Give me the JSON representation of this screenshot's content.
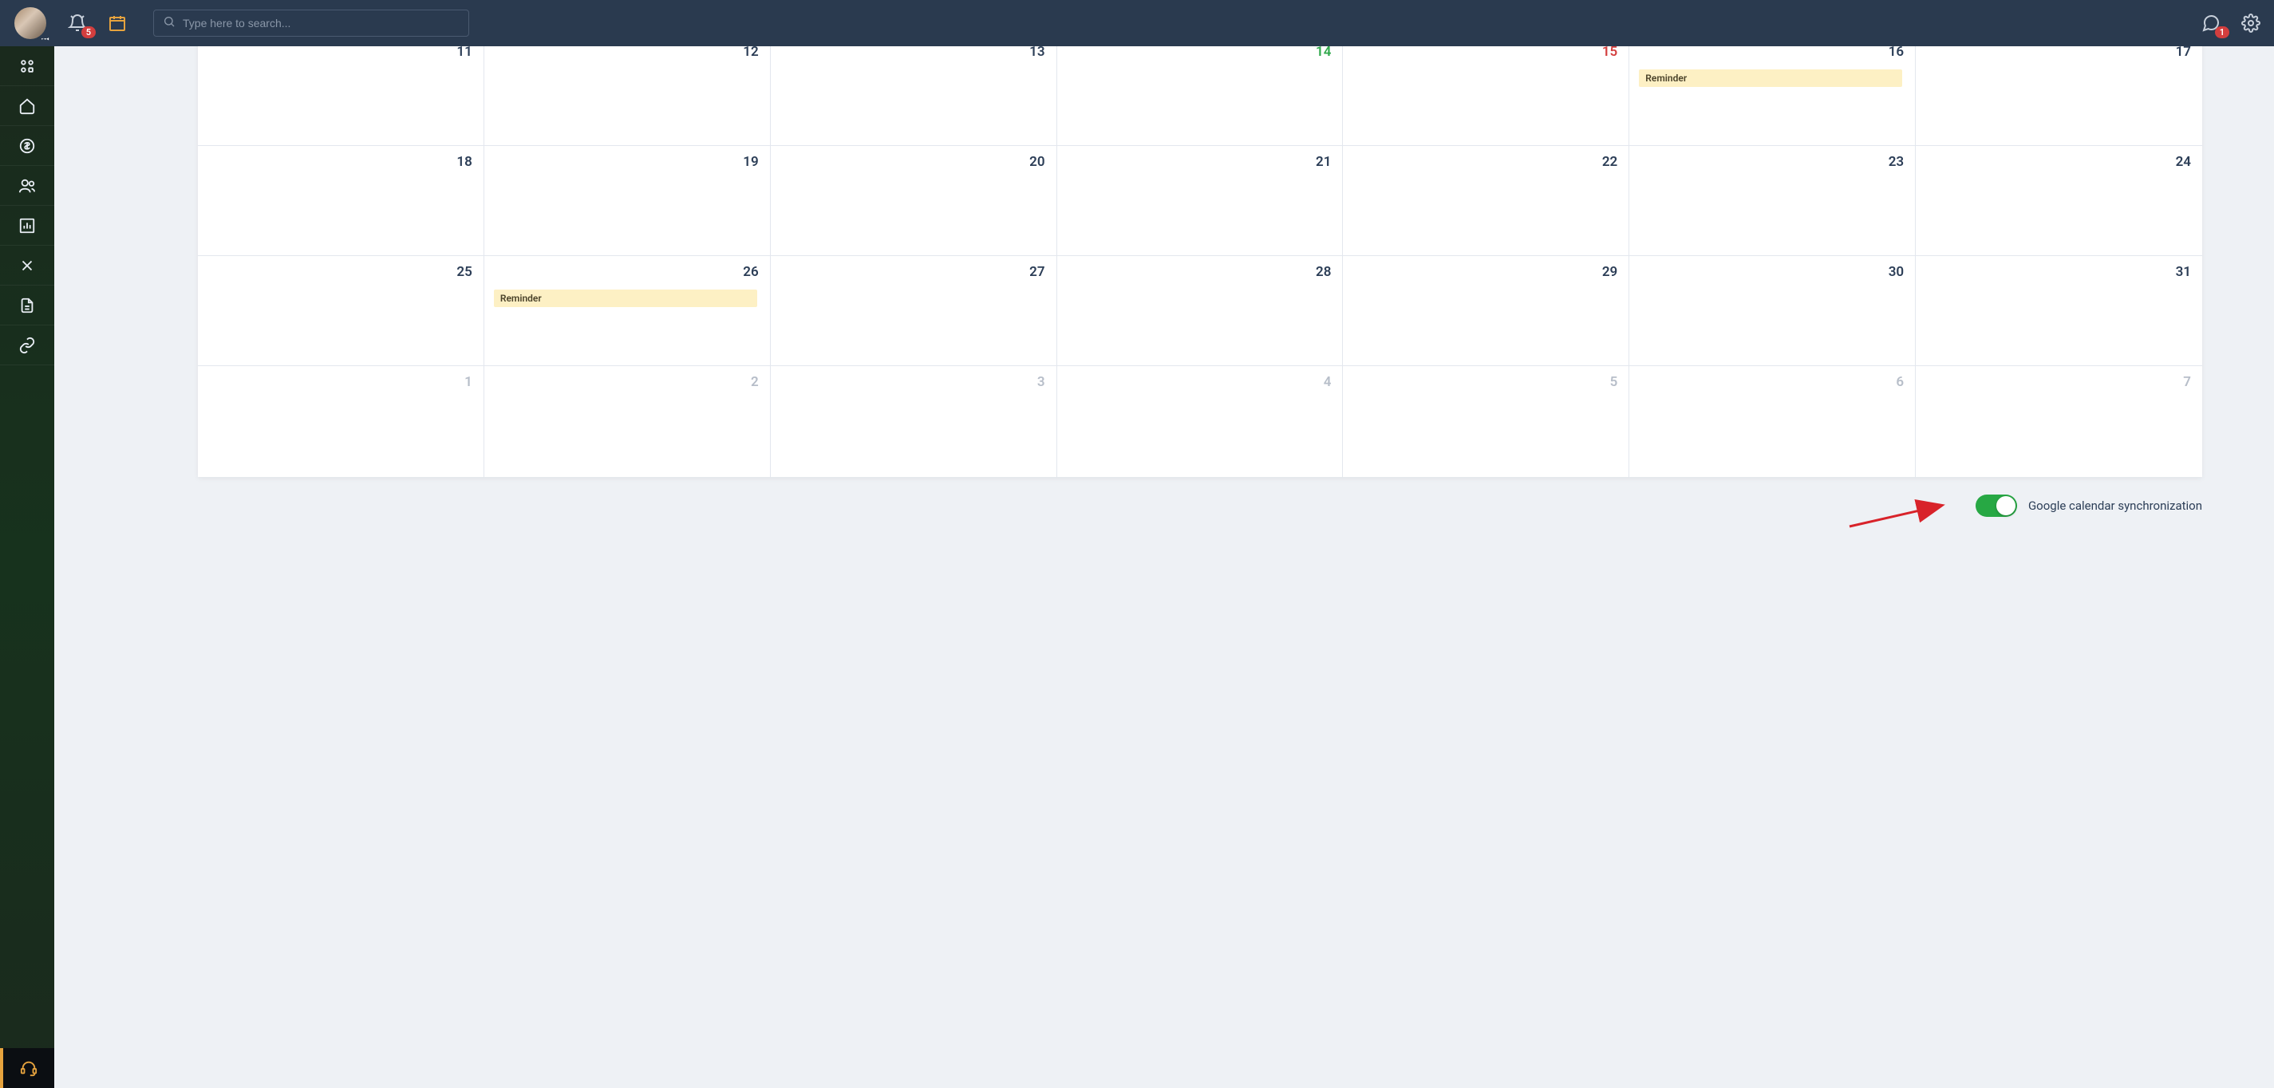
{
  "topbar": {
    "notifications_badge": "5",
    "messages_badge": "1",
    "search_placeholder": "Type here to search..."
  },
  "calendar": {
    "rows": [
      {
        "truncated": true,
        "cells": [
          {
            "n": ""
          },
          {
            "n": ""
          },
          {
            "n": ""
          },
          {
            "n": ""
          },
          {
            "n": ""
          },
          {
            "n": ""
          },
          {
            "n": ""
          }
        ]
      },
      {
        "cells": [
          {
            "n": "11"
          },
          {
            "n": "12"
          },
          {
            "n": "13"
          },
          {
            "n": "14",
            "color": "green"
          },
          {
            "n": "15",
            "color": "red"
          },
          {
            "n": "16",
            "event": "Reminder"
          },
          {
            "n": "17"
          }
        ]
      },
      {
        "cells": [
          {
            "n": "18"
          },
          {
            "n": "19"
          },
          {
            "n": "20"
          },
          {
            "n": "21"
          },
          {
            "n": "22"
          },
          {
            "n": "23"
          },
          {
            "n": "24"
          }
        ]
      },
      {
        "cells": [
          {
            "n": "25"
          },
          {
            "n": "26",
            "event": "Reminder"
          },
          {
            "n": "27"
          },
          {
            "n": "28"
          },
          {
            "n": "29"
          },
          {
            "n": "30"
          },
          {
            "n": "31"
          }
        ]
      },
      {
        "gray": true,
        "cells": [
          {
            "n": "1"
          },
          {
            "n": "2"
          },
          {
            "n": "3"
          },
          {
            "n": "4"
          },
          {
            "n": "5"
          },
          {
            "n": "6"
          },
          {
            "n": "7"
          }
        ]
      }
    ]
  },
  "sync": {
    "label": "Google calendar synchronization",
    "on": true
  },
  "sidenav": {
    "items": [
      "apps",
      "home",
      "finance",
      "people",
      "chart",
      "tools",
      "doc",
      "link"
    ],
    "bottom": "support"
  }
}
